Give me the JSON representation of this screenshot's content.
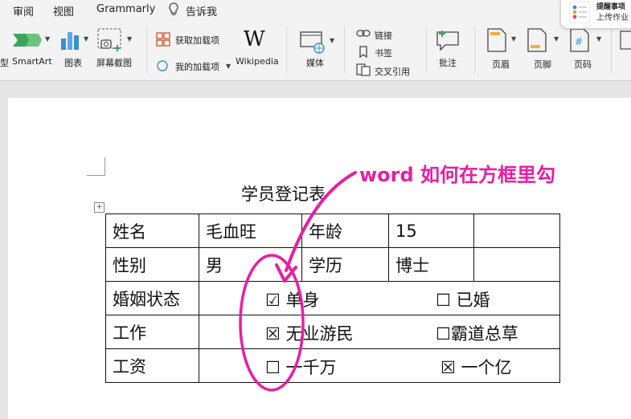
{
  "tabs": [
    "审阅",
    "视图",
    "Grammarly",
    "告诉我"
  ],
  "ribbon": {
    "partial_label": "型",
    "smartart": "SmartArt",
    "chart": "图表",
    "screenshot": "屏幕截图",
    "get_addins": "获取加载项",
    "my_addins": "我的加载项",
    "wikipedia": "Wikipedia",
    "media": "媒体",
    "link": "链接",
    "bookmark": "书签",
    "cross_ref": "交叉引用",
    "comment": "批注",
    "header": "页眉",
    "footer": "页脚",
    "page_number": "页码"
  },
  "notification": {
    "title": "提醒事项",
    "subtitle": "上传作业"
  },
  "document": {
    "title": "学员登记表",
    "rows": [
      [
        "姓名",
        "毛血旺",
        "年龄",
        "15",
        ""
      ],
      [
        "性别",
        "男",
        "学历",
        "博士",
        ""
      ]
    ],
    "marital": {
      "label": "婚姻状态",
      "opt1": "☑ 单身",
      "opt2": "☐ 已婚"
    },
    "work": {
      "label": "工作",
      "opt1": "☒ 无业游民",
      "opt2": "☐霸道总草"
    },
    "salary": {
      "label": "工资",
      "opt1": "☐ 一千万",
      "opt2": "☒ 一个亿"
    }
  },
  "annotation": "word 如何在方框里勾",
  "colors": {
    "annotation": "#e81ea3",
    "ribbon_bg": "#f3f3f3",
    "page_bg": "#ffffff",
    "canvas_bg": "#e6e6e6"
  }
}
